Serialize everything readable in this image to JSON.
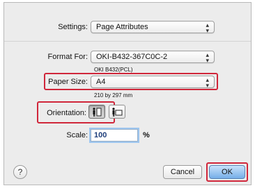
{
  "settings": {
    "label": "Settings:",
    "value": "Page Attributes"
  },
  "format_for": {
    "label": "Format For:",
    "value": "OKI-B432-367C0C-2",
    "sub": "OKI B432(PCL)"
  },
  "paper_size": {
    "label": "Paper Size:",
    "value": "A4",
    "sub": "210 by 297 mm"
  },
  "orientation": {
    "label": "Orientation:",
    "options": [
      "portrait",
      "landscape"
    ],
    "selected": "portrait"
  },
  "scale": {
    "label": "Scale:",
    "value": "100",
    "unit": "%"
  },
  "footer": {
    "help": "?",
    "cancel": "Cancel",
    "ok": "OK"
  },
  "colors": {
    "highlight": "#d0263a",
    "accent": "#75aee8"
  }
}
